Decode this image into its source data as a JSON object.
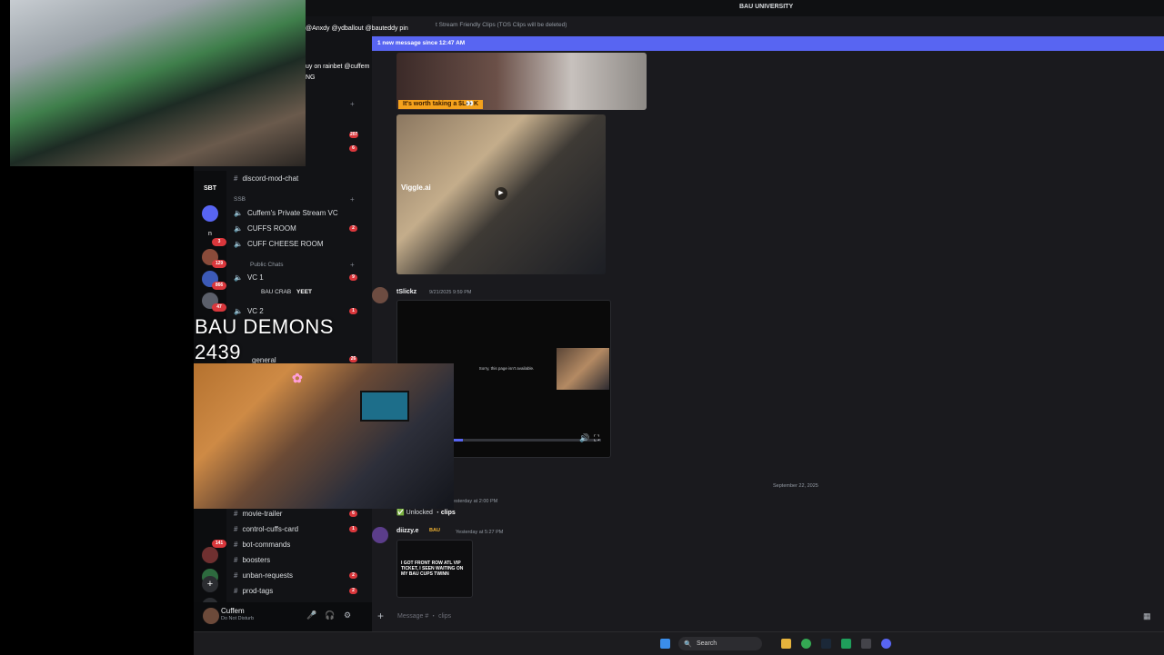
{
  "window": {
    "title": "BAU UNIVERSITY"
  },
  "sidebar": {
    "server_labels": [
      "SBT",
      "n"
    ],
    "server_badges": [
      "3",
      "129",
      "866",
      "47"
    ],
    "top_badges": [
      "207",
      "6"
    ],
    "voice_top": {
      "name": "discord-mod-chat"
    },
    "category_1": "SSB",
    "channels_a": [
      {
        "name": "Cuffem's Private Stream VC"
      },
      {
        "name": "CUFFS ROOM",
        "badge": "2"
      },
      {
        "name": "CUFF CHEESE ROOM"
      }
    ],
    "category_2": "Public Chats",
    "channels_b": [
      {
        "name": "VC 1",
        "badge": "9"
      },
      {
        "name": "BAU CRAB",
        "tag": "YEET"
      },
      {
        "name": "VC 2",
        "badge": "1"
      },
      {
        "name": "general",
        "badge": "26"
      }
    ],
    "channels_c": [
      {
        "name": "movie-trailer",
        "badge": "6"
      },
      {
        "name": "control-cuffs-card",
        "badge": "1"
      },
      {
        "name": "bot-commands"
      },
      {
        "name": "boosters"
      },
      {
        "name": "unban-requests",
        "badge": "2"
      },
      {
        "name": "prod-tags",
        "badge": "2"
      }
    ],
    "rail_badge": "141"
  },
  "user_panel": {
    "name": "Cuffem",
    "status": "Do Not Disturb"
  },
  "chat": {
    "topic": "t Stream Friendly Clips (TOS Clips will be deleted)",
    "new_messages": "1 new message since 12:47 AM",
    "media_1_caption": "It's worth taking a $L👀K",
    "media_2_watermark": "Viggle.ai",
    "msg_1": {
      "author": "tSlickz",
      "time": "9/21/2025 9:59 PM"
    },
    "video_text": "Sorry, this page isn't available.",
    "date_divider": "September 22, 2025",
    "msg_2_time": "esterday at 2:00 PM",
    "unlocked": {
      "prefix": "Unlocked",
      "channel": "clips"
    },
    "msg_3": {
      "author": "diizzy.e",
      "tag": "BAU",
      "time": "Yesterday at 5:27 PM"
    },
    "media_4_text": "I GOT FRONT ROW ATL VIP TICKET, I SEEN WAITING ON MY BAU CUPS TWINN",
    "composer_placeholder": "Message # ・ clips"
  },
  "overlays": {
    "stream_title_line1": "BAU DEMONS",
    "stream_title_line2": "2439",
    "popup_line_1": "@Anxdy @ydballout @bauteddy pin",
    "popup_line_2": "uy on rainbet @cuffem",
    "popup_line_3": "NG"
  },
  "taskbar": {
    "search_label": "Search"
  },
  "colors": {
    "accent": "#5865f2",
    "badge": "#da373c",
    "bg": "#111214"
  }
}
